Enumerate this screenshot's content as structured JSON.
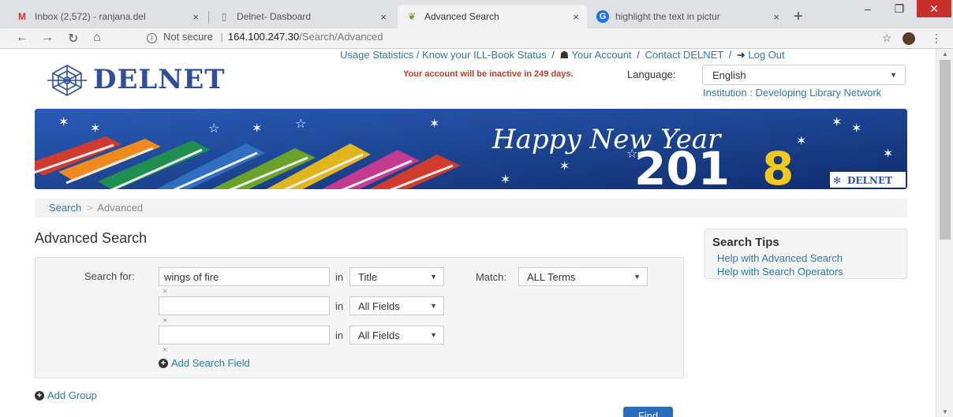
{
  "browser": {
    "tabs": [
      {
        "title": "Inbox (2,572) - ranjana.del",
        "icon": "gmail-icon"
      },
      {
        "title": "Delnet- Dasboard",
        "icon": "document-icon"
      },
      {
        "title": "Advanced Search",
        "icon": "search-leaf-icon"
      },
      {
        "title": "highlight the text in pictur",
        "icon": "google-icon"
      }
    ],
    "security_label": "Not secure",
    "url_host": "164.100.247.30",
    "url_path": "/Search/Advanced"
  },
  "header": {
    "links": [
      "Usage Statistics / Know your ILL-Book Status",
      "Your Account",
      "Contact DELNET",
      "Log Out"
    ],
    "logo_text": "DELNET",
    "warning": "Your account will be inactive in 249 days.",
    "language_label": "Language:",
    "language_value": "English",
    "institution": "Institution : Developing Library Network"
  },
  "banner": {
    "greeting": "Happy New Year",
    "year_digits": "201",
    "year_last": "8",
    "brand": "DELNET"
  },
  "breadcrumb": {
    "home": "Search",
    "separator": ">",
    "current": "Advanced"
  },
  "search": {
    "heading": "Advanced Search",
    "search_for_label": "Search for:",
    "in_label": "in",
    "match_label": "Match:",
    "match_value": "ALL Terms",
    "rows": [
      {
        "value": "wings of fire",
        "field": "Title"
      },
      {
        "value": "",
        "field": "All Fields"
      },
      {
        "value": "",
        "field": "All Fields"
      }
    ],
    "remove_glyph": "×",
    "add_field": "Add Search Field",
    "add_group": "Add Group",
    "find": "Find"
  },
  "tips": {
    "heading": "Search Tips",
    "links": [
      "Help with Advanced Search",
      "Help with Search Operators"
    ]
  }
}
